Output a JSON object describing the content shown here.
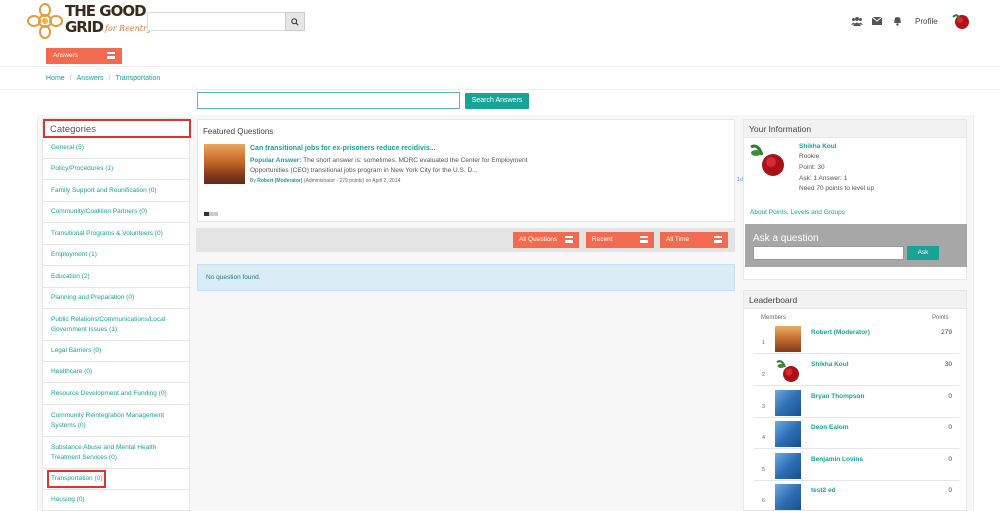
{
  "header": {
    "logo_line1": "THE GOOD",
    "logo_line2": "GRID",
    "logo_sub": "for Reentry",
    "search_placeholder": "",
    "profile_label": "Profile",
    "icons": [
      "users-icon",
      "envelope-icon",
      "bell-icon",
      "search-icon"
    ]
  },
  "tab": {
    "answers_label": "Answers"
  },
  "breadcrumb": {
    "home": "Home",
    "answers": "Answers",
    "current": "Transportation"
  },
  "search": {
    "button_label": "Search Answers",
    "placeholder": ""
  },
  "categories": {
    "title": "Categories",
    "items": [
      {
        "label": "General (5)"
      },
      {
        "label": "Policy/Procedures (1)"
      },
      {
        "label": "Family Support and Reunification (0)"
      },
      {
        "label": "Community/Coalition Partners (0)"
      },
      {
        "label": "Transitional Programs & Volunteers (0)"
      },
      {
        "label": "Employment (1)"
      },
      {
        "label": "Education (2)"
      },
      {
        "label": "Planning and Preparation (0)"
      },
      {
        "label": "Public Relations/Communications/Local Government Issues (1)"
      },
      {
        "label": "Legal Barriers (0)"
      },
      {
        "label": "Healthcare (0)"
      },
      {
        "label": "Resource Development and Funding (0)"
      },
      {
        "label": "Community Reintegration Management Systems (0)"
      },
      {
        "label": "Substance Abuse and Mental Health Treatment Services (0)"
      },
      {
        "label": "Transportation (0)"
      },
      {
        "label": "Housing (0)"
      }
    ]
  },
  "featured": {
    "title": "Featured Questions",
    "question": "Can transitional jobs for ex-prisoners reduce recidivis...",
    "popular_label": "Popular Answer:",
    "popular_text": "The short answer is: sometimes. MDRC evaluated the Center for Employment Opportunities (CEO) transitional jobs program in New York City for the U.S. D...",
    "by_label": "By",
    "author": "Robert (Moderator)",
    "author_meta": "(Administrator - 279 points)",
    "date": "on April 2, 2014",
    "meta_count": "1↺"
  },
  "filters": {
    "all_questions": "All Questions",
    "recent": "Recent",
    "all_time": "All Time"
  },
  "no_questions": "No question found.",
  "your_info": {
    "title": "Your Information",
    "name": "Shikha Koul",
    "rank": "Rookie",
    "points": "Point: 30",
    "ask_answer": "Ask: 1    Answer: 1",
    "next_level": "Need 70 points to level up",
    "about_link": "About Points, Levels and Groups",
    "ask_title": "Ask a question",
    "ask_button": "Ask"
  },
  "leaderboard": {
    "title": "Leaderboard",
    "members_label": "Members",
    "points_label": "Points",
    "rows": [
      {
        "rank": "1",
        "name": "Robert (Moderator)",
        "points": "279",
        "avatar": "desert"
      },
      {
        "rank": "2",
        "name": "Shikha Koul",
        "points": "30",
        "avatar": "rose"
      },
      {
        "rank": "3",
        "name": "Bryan Thompson",
        "points": "0",
        "avatar": "blue"
      },
      {
        "rank": "4",
        "name": "Deon Ealom",
        "points": "0",
        "avatar": "blue"
      },
      {
        "rank": "5",
        "name": "Benjamin Lovins",
        "points": "0",
        "avatar": "blue"
      },
      {
        "rank": "6",
        "name": "test2 ed",
        "points": "0",
        "avatar": "blue"
      }
    ]
  }
}
